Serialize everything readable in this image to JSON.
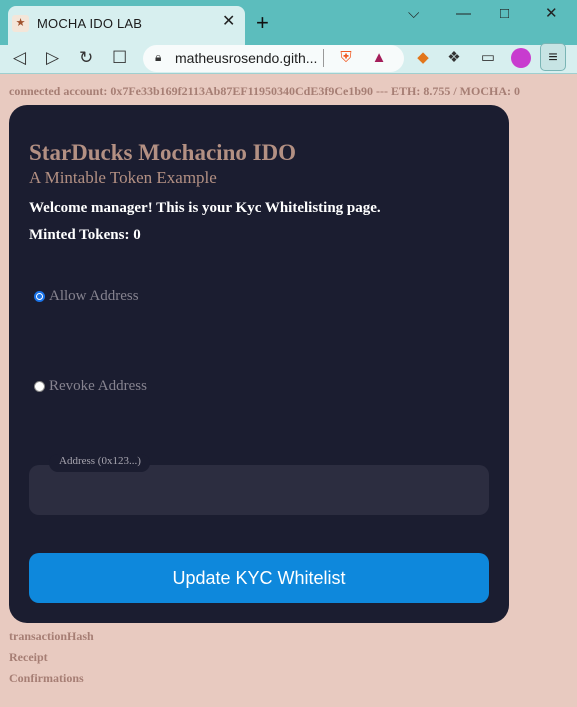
{
  "browser": {
    "tab_title": "MOCHA IDO LAB",
    "url": "matheusrosendo.gith...",
    "icons": {
      "favicon": "duck-favicon-icon",
      "close": "close-icon",
      "new_tab": "plus-icon",
      "minimize": "minimize-icon",
      "maximize": "maximize-icon",
      "window_close": "window-close-icon",
      "dropdown": "chevron-down-icon",
      "back": "back-icon",
      "forward": "forward-icon",
      "reload": "reload-icon",
      "bookmark": "bookmark-icon",
      "lock": "lock-icon",
      "brave": "brave-shield-icon",
      "rewards": "brave-rewards-icon",
      "metamask": "metamask-fox-icon",
      "extensions": "puzzle-icon",
      "wallet": "wallet-icon",
      "profile": "profile-avatar-icon",
      "menu": "hamburger-menu-icon"
    }
  },
  "page": {
    "account_line": "connected account: 0x7Fe33b169f2113Ab87EF11950340CdE3f9Ce1b90 --- ETH: 8.755 / MOCHA: 0",
    "card": {
      "title": "StarDucks Mochacino IDO",
      "subtitle": "A Mintable Token Example",
      "welcome": "Welcome manager! This is your Kyc Whitelisting page.",
      "minted": "Minted Tokens: 0",
      "radios": [
        {
          "label": "Allow Address",
          "checked": true
        },
        {
          "label": "Revoke Address",
          "checked": false
        }
      ],
      "address_input": {
        "label": "Address (0x123...)",
        "value": ""
      },
      "button_label": "Update KYC Whitelist"
    },
    "footer": [
      "transactionHash",
      "Receipt",
      "Confirmations"
    ]
  },
  "colors": {
    "page_bg": "#e8cac0",
    "card_bg": "#1b1d30",
    "title": "#b39083",
    "button": "#0e88dc",
    "browser_frame": "#5cbdbd"
  }
}
